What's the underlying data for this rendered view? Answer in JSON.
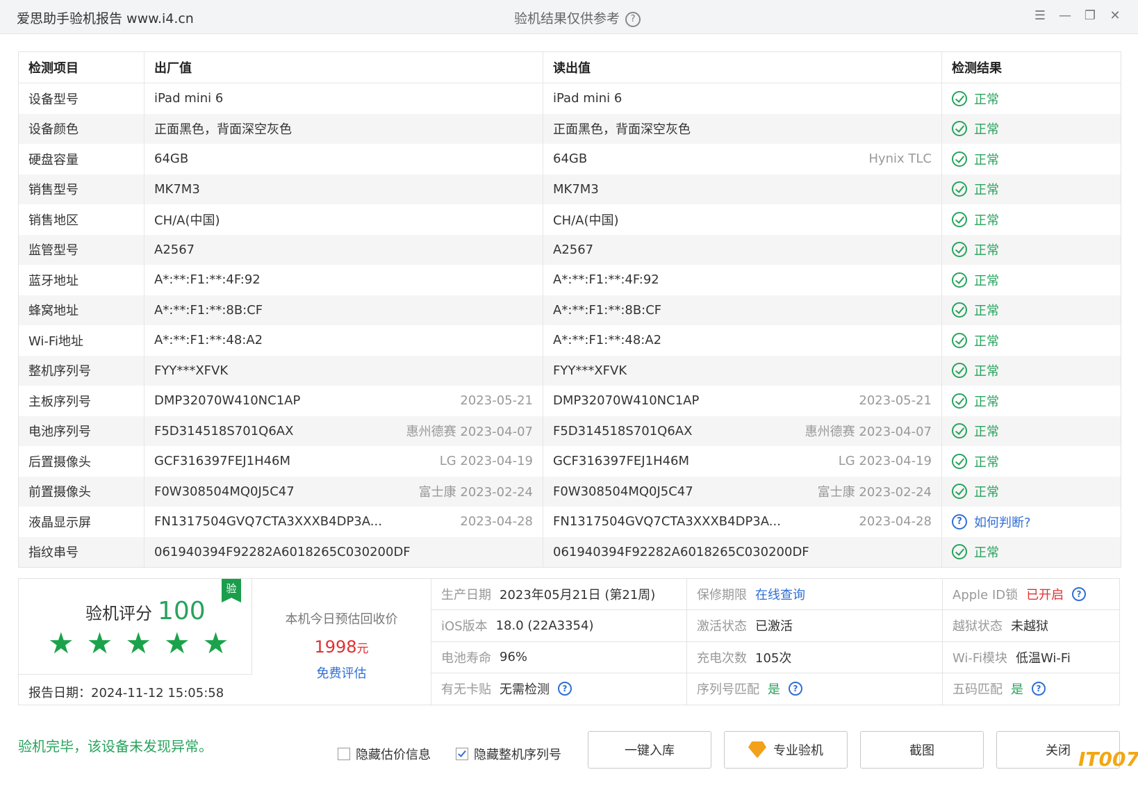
{
  "titlebar": {
    "app_title": "爱思助手验机报告 www.i4.cn",
    "center_note": "验机结果仅供参考",
    "help_icon": "?",
    "buttons": [
      "menu-icon",
      "minimize-icon",
      "restore-icon",
      "close-icon"
    ]
  },
  "table": {
    "headers": [
      "检测项目",
      "出厂值",
      "读出值",
      "检测结果"
    ],
    "rows": [
      {
        "item": "设备型号",
        "factory": "iPad mini 6",
        "factory_note": "",
        "read": "iPad mini 6",
        "read_note": "",
        "result": "正常",
        "status": "ok"
      },
      {
        "item": "设备颜色",
        "factory": "正面黑色，背面深空灰色",
        "factory_note": "",
        "read": "正面黑色，背面深空灰色",
        "read_note": "",
        "result": "正常",
        "status": "ok"
      },
      {
        "item": "硬盘容量",
        "factory": "64GB",
        "factory_note": "",
        "read": "64GB",
        "read_note": "Hynix TLC",
        "result": "正常",
        "status": "ok"
      },
      {
        "item": "销售型号",
        "factory": "MK7M3",
        "factory_note": "",
        "read": "MK7M3",
        "read_note": "",
        "result": "正常",
        "status": "ok"
      },
      {
        "item": "销售地区",
        "factory": "CH/A(中国)",
        "factory_note": "",
        "read": "CH/A(中国)",
        "read_note": "",
        "result": "正常",
        "status": "ok"
      },
      {
        "item": "监管型号",
        "factory": "A2567",
        "factory_note": "",
        "read": "A2567",
        "read_note": "",
        "result": "正常",
        "status": "ok"
      },
      {
        "item": "蓝牙地址",
        "factory": "A*:**:F1:**:4F:92",
        "factory_note": "",
        "read": "A*:**:F1:**:4F:92",
        "read_note": "",
        "result": "正常",
        "status": "ok"
      },
      {
        "item": "蜂窝地址",
        "factory": "A*:**:F1:**:8B:CF",
        "factory_note": "",
        "read": "A*:**:F1:**:8B:CF",
        "read_note": "",
        "result": "正常",
        "status": "ok"
      },
      {
        "item": "Wi-Fi地址",
        "factory": "A*:**:F1:**:48:A2",
        "factory_note": "",
        "read": "A*:**:F1:**:48:A2",
        "read_note": "",
        "result": "正常",
        "status": "ok"
      },
      {
        "item": "整机序列号",
        "factory": "FYY***XFVK",
        "factory_note": "",
        "read": "FYY***XFVK",
        "read_note": "",
        "result": "正常",
        "status": "ok"
      },
      {
        "item": "主板序列号",
        "factory": "DMP32070W410NC1AP",
        "factory_note": "2023-05-21",
        "read": "DMP32070W410NC1AP",
        "read_note": "2023-05-21",
        "result": "正常",
        "status": "ok"
      },
      {
        "item": "电池序列号",
        "factory": "F5D314518S701Q6AX",
        "factory_note": "惠州德赛 2023-04-07",
        "read": "F5D314518S701Q6AX",
        "read_note": "惠州德赛 2023-04-07",
        "result": "正常",
        "status": "ok"
      },
      {
        "item": "后置摄像头",
        "factory": "GCF316397FEJ1H46M",
        "factory_note": "LG 2023-04-19",
        "read": "GCF316397FEJ1H46M",
        "read_note": "LG 2023-04-19",
        "result": "正常",
        "status": "ok"
      },
      {
        "item": "前置摄像头",
        "factory": "F0W308504MQ0J5C47",
        "factory_note": "富士康 2023-02-24",
        "read": "F0W308504MQ0J5C47",
        "read_note": "富士康 2023-02-24",
        "result": "正常",
        "status": "ok"
      },
      {
        "item": "液晶显示屏",
        "factory": "FN1317504GVQ7CTA3XXXB4DP3A...",
        "factory_note": "2023-04-28",
        "read": "FN1317504GVQ7CTA3XXXB4DP3A...",
        "read_note": "2023-04-28",
        "result": "如何判断?",
        "status": "question"
      },
      {
        "item": "指纹串号",
        "factory": "061940394F92282A6018265C030200DF",
        "factory_note": "",
        "read": "061940394F92282A6018265C030200DF",
        "read_note": "",
        "result": "正常",
        "status": "ok"
      }
    ]
  },
  "summary": {
    "score_label": "验机评分",
    "score": "100",
    "badge": "验",
    "stars": 5,
    "report_date": "报告日期：2024-11-12 15:05:58",
    "price_title": "本机今日预估回收价",
    "price": "1998",
    "price_unit": "元",
    "price_link": "免费评估",
    "grid": [
      [
        {
          "label": "生产日期",
          "value": "2023年05月21日 (第21周)",
          "style": "normal",
          "help": false
        },
        {
          "label": "保修期限",
          "value": "在线查询",
          "style": "blue",
          "help": false
        },
        {
          "label": "Apple ID锁",
          "value": "已开启",
          "style": "red",
          "help": true
        }
      ],
      [
        {
          "label": "iOS版本",
          "value": "18.0 (22A3354)",
          "style": "normal",
          "help": false
        },
        {
          "label": "激活状态",
          "value": "已激活",
          "style": "normal",
          "help": false
        },
        {
          "label": "越狱状态",
          "value": "未越狱",
          "style": "normal",
          "help": false
        }
      ],
      [
        {
          "label": "电池寿命",
          "value": "96%",
          "style": "normal",
          "help": false
        },
        {
          "label": "充电次数",
          "value": "105次",
          "style": "normal",
          "help": false
        },
        {
          "label": "Wi-Fi模块",
          "value": "低温Wi-Fi",
          "style": "normal",
          "help": false
        }
      ],
      [
        {
          "label": "有无卡贴",
          "value": "无需检测",
          "style": "normal",
          "help": true
        },
        {
          "label": "序列号匹配",
          "value": "是",
          "style": "green",
          "help": true
        },
        {
          "label": "五码匹配",
          "value": "是",
          "style": "green",
          "help": true
        }
      ]
    ]
  },
  "footer": {
    "message": "验机完毕，该设备未发现异常。",
    "checkbox_hide_price": {
      "label": "隐藏估价信息",
      "checked": false
    },
    "checkbox_hide_serial": {
      "label": "隐藏整机序列号",
      "checked": true
    },
    "btn_import": "一键入库",
    "btn_pro": "专业验机",
    "btn_screenshot": "截图",
    "btn_close": "关闭"
  },
  "watermark": "IT007"
}
